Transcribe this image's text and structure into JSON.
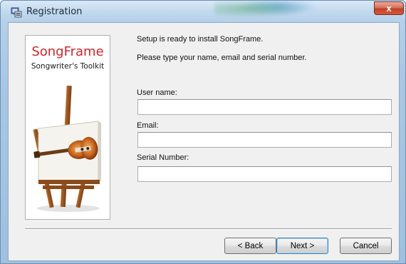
{
  "window": {
    "title": "Registration",
    "close_label": "x"
  },
  "brand": {
    "name": "SongFrame",
    "tagline": "Songwriter's Toolkit"
  },
  "messages": {
    "line1": "Setup is ready to install SongFrame.",
    "line2": "Please type your name, email and serial number."
  },
  "form": {
    "username_label": "User name:",
    "username_value": "",
    "email_label": "Email:",
    "email_value": "",
    "serial_label": "Serial Number:",
    "serial_value": ""
  },
  "buttons": {
    "back": "< Back",
    "next": "Next >",
    "cancel": "Cancel"
  },
  "colors": {
    "brand_red": "#c8282c",
    "title_bar": "#c4dbef",
    "close_red": "#c24026",
    "default_button_border": "#3c7fb1"
  },
  "icons": {
    "app": "installer-computer-icon",
    "close": "close-x-icon",
    "art": "easel-with-guitar-canvas"
  }
}
